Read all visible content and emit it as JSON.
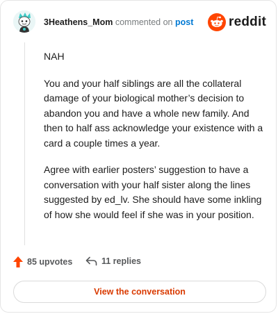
{
  "header": {
    "username": "3Heathens_Mom",
    "verb": "commented on",
    "link_text": "post",
    "brand": "reddit"
  },
  "comment": {
    "paragraphs": [
      "NAH",
      "You and your half siblings are all the collateral damage of your biological mother’s decision to abandon you and have a whole new family. And then to half ass acknowledge your existence with a card a couple times a year.",
      "Agree with earlier posters’ suggestion to have a conversation with your half sister along the lines suggested by ed_lv. She should have some inkling of how she would feel if she was in your position."
    ]
  },
  "footer": {
    "upvotes": "85 upvotes",
    "replies": "11 replies",
    "view_button": "View the conversation"
  },
  "icons": {
    "avatar": "avatar",
    "brand_logo": "reddit-snoo-icon",
    "upvote": "upvote-arrow-icon",
    "reply": "reply-arrow-icon"
  },
  "colors": {
    "accent": "#ff4500",
    "link": "#0079d3",
    "button_text": "#d93a00"
  }
}
